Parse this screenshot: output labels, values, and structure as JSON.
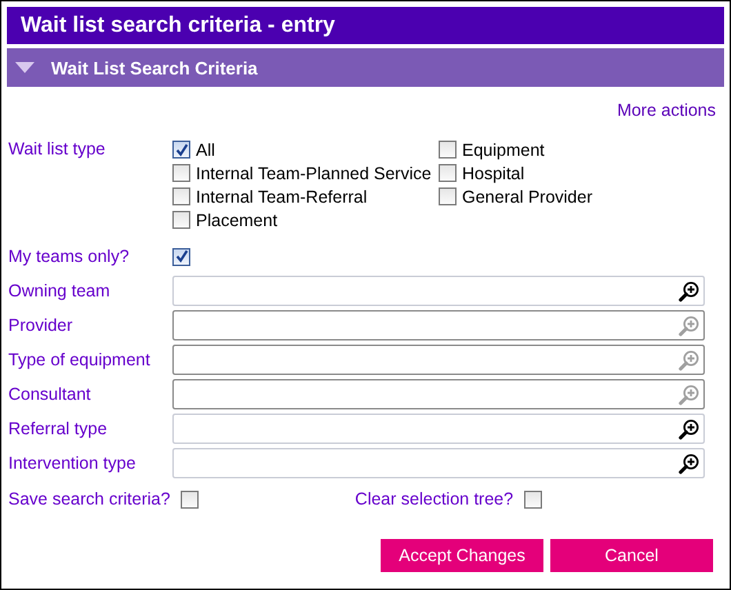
{
  "window": {
    "title": "Wait list search criteria - entry"
  },
  "section": {
    "title": "Wait List Search Criteria",
    "expanded": true
  },
  "more_actions": "More actions",
  "wait_list_type": {
    "label": "Wait list type",
    "options": [
      {
        "label": "All",
        "checked": true
      },
      {
        "label": "Equipment",
        "checked": false
      },
      {
        "label": "Internal Team-Planned Service",
        "checked": false
      },
      {
        "label": "Hospital",
        "checked": false
      },
      {
        "label": "Internal Team-Referral",
        "checked": false
      },
      {
        "label": "General Provider",
        "checked": false
      },
      {
        "label": "Placement",
        "checked": false
      }
    ]
  },
  "my_teams_only": {
    "label": "My teams only?",
    "checked": true
  },
  "fields": [
    {
      "label": "Owning team",
      "disabled": false
    },
    {
      "label": "Provider",
      "disabled": true
    },
    {
      "label": "Type of equipment",
      "disabled": true
    },
    {
      "label": "Consultant",
      "disabled": true
    },
    {
      "label": "Referral type",
      "disabled": false
    },
    {
      "label": "Intervention type",
      "disabled": false
    }
  ],
  "save_search_criteria": {
    "label": "Save search criteria?",
    "checked": false
  },
  "clear_selection_tree": {
    "label": "Clear selection tree?",
    "checked": false
  },
  "buttons": [
    "Accept Changes",
    "Cancel"
  ]
}
